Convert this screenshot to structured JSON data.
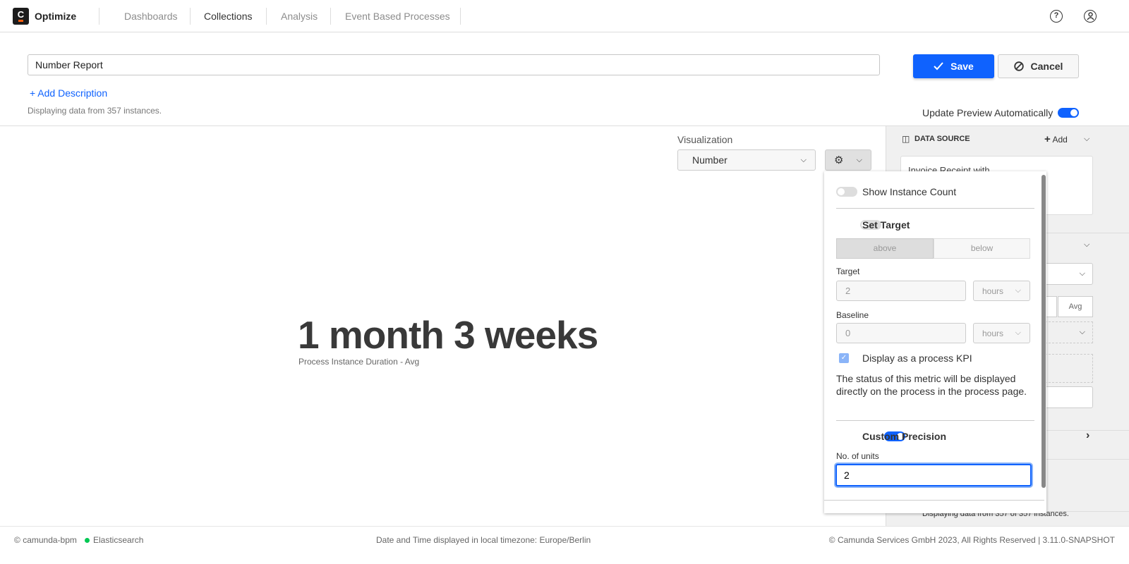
{
  "header": {
    "brand": "Optimize",
    "nav": [
      "Dashboards",
      "Collections",
      "Analysis",
      "Event Based Processes"
    ],
    "active_nav": "Collections",
    "help_icon": "help-icon",
    "user_icon": "user-icon"
  },
  "report": {
    "name": "Number Report",
    "add_description": "+ Add Description",
    "instances_text": "Displaying data from 357 instances.",
    "save_label": "Save",
    "cancel_label": "Cancel",
    "update_preview_label": "Update Preview Automatically",
    "update_preview_on": true
  },
  "visualization": {
    "label": "Visualization",
    "selected": "Number"
  },
  "number": {
    "value": "1 month 3 weeks",
    "caption": "Process Instance Duration - Avg"
  },
  "popover": {
    "show_instance_count": "Show Instance Count",
    "show_instance_count_on": false,
    "set_target": "Set Target",
    "set_target_on": false,
    "above": "above",
    "below": "below",
    "target_label": "Target",
    "target_value": "2",
    "target_unit": "hours",
    "baseline_label": "Baseline",
    "baseline_value": "0",
    "baseline_unit": "hours",
    "kpi_label": "Display as a process KPI",
    "kpi_checked": true,
    "kpi_help": "The status of this metric will be displayed directly on the process in the process page.",
    "custom_precision": "Custom Precision",
    "custom_precision_on": true,
    "units_label": "No. of units",
    "units_value": "2"
  },
  "sidebar": {
    "data_source_title": "DATA SOURCE",
    "add_label": "Add",
    "source_name": "Invoice Receipt with",
    "agg_label": "Avg",
    "footer_text": "Displaying data from 357 of 357 instances."
  },
  "footer": {
    "engine": "camunda-bpm",
    "db": "Elasticsearch",
    "timezone": "Date and Time displayed in local timezone: Europe/Berlin",
    "copyright": "© Camunda Services GmbH 2023, All Rights Reserved | 3.11.0-SNAPSHOT"
  },
  "colors": {
    "accent": "#0f62fe",
    "status_ok": "#00c853"
  }
}
